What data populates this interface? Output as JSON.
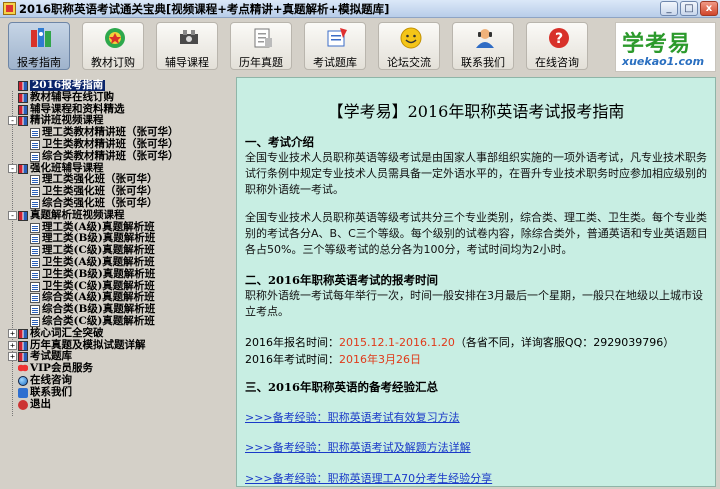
{
  "window": {
    "title": "2016职称英语考试通关宝典[视频课程+考点精讲+真题解析+模拟题库]",
    "buttons": {
      "minimize": "_",
      "maximize": "□",
      "close": "x"
    }
  },
  "toolbar": [
    {
      "label": "报考指南",
      "icon": "guide-icon",
      "active": true
    },
    {
      "label": "教材订购",
      "icon": "order-icon",
      "active": false
    },
    {
      "label": "辅导课程",
      "icon": "course-icon",
      "active": false
    },
    {
      "label": "历年真题",
      "icon": "past-exam-icon",
      "active": false
    },
    {
      "label": "考试题库",
      "icon": "question-bank-icon",
      "active": false
    },
    {
      "label": "论坛交流",
      "icon": "forum-icon",
      "active": false
    },
    {
      "label": "联系我们",
      "icon": "contact-icon",
      "active": false
    },
    {
      "label": "在线咨询",
      "icon": "help-icon",
      "active": false
    }
  ],
  "logo": {
    "cn": "学考易",
    "en": "xuekao1.com"
  },
  "tree": [
    {
      "label": "2016报考指南",
      "level": 0,
      "icon": "book",
      "selected": true
    },
    {
      "label": "教材辅导在线订购",
      "level": 0,
      "icon": "book"
    },
    {
      "label": "辅导课程和资料精选",
      "level": 0,
      "icon": "book"
    },
    {
      "label": "精讲班视频课程",
      "level": 0,
      "icon": "book",
      "expand": "-"
    },
    {
      "label": "理工类教材精讲班（张可华）",
      "level": 1,
      "icon": "doc"
    },
    {
      "label": "卫生类教材精讲班（张可华）",
      "level": 1,
      "icon": "doc"
    },
    {
      "label": "综合类教材精讲班（张可华）",
      "level": 1,
      "icon": "doc"
    },
    {
      "label": "强化班辅导课程",
      "level": 0,
      "icon": "book",
      "expand": "-"
    },
    {
      "label": "理工类强化班（张可华）",
      "level": 1,
      "icon": "doc"
    },
    {
      "label": "卫生类强化班（张可华）",
      "level": 1,
      "icon": "doc"
    },
    {
      "label": "综合类强化班（张可华）",
      "level": 1,
      "icon": "doc"
    },
    {
      "label": "真题解析班视频课程",
      "level": 0,
      "icon": "book",
      "expand": "-"
    },
    {
      "label": "理工类(A级)真题解析班",
      "level": 1,
      "icon": "doc"
    },
    {
      "label": "理工类(B级)真题解析班",
      "level": 1,
      "icon": "doc"
    },
    {
      "label": "理工类(C级)真题解析班",
      "level": 1,
      "icon": "doc"
    },
    {
      "label": "卫生类(A级)真题解析班",
      "level": 1,
      "icon": "doc"
    },
    {
      "label": "卫生类(B级)真题解析班",
      "level": 1,
      "icon": "doc"
    },
    {
      "label": "卫生类(C级)真题解析班",
      "level": 1,
      "icon": "doc"
    },
    {
      "label": "综合类(A级)真题解析班",
      "level": 1,
      "icon": "doc"
    },
    {
      "label": "综合类(B级)真题解析班",
      "level": 1,
      "icon": "doc"
    },
    {
      "label": "综合类(C级)真题解析班",
      "level": 1,
      "icon": "doc"
    },
    {
      "label": "核心词汇全突破",
      "level": 0,
      "icon": "book",
      "expand": "+"
    },
    {
      "label": "历年真题及模拟试题详解",
      "level": 0,
      "icon": "book",
      "expand": "+"
    },
    {
      "label": "考试题库",
      "level": 0,
      "icon": "book",
      "expand": "+"
    },
    {
      "label": "VIP会员服务",
      "level": 0,
      "icon": "heart"
    },
    {
      "label": "在线咨询",
      "level": 0,
      "icon": "globe"
    },
    {
      "label": "联系我们",
      "level": 0,
      "icon": "phone"
    },
    {
      "label": "退出",
      "level": 0,
      "icon": "exit"
    }
  ],
  "content": {
    "title": "【学考易】2016年职称英语考试报考指南",
    "s1_title": "一、考试介绍",
    "s1_p1": "全国专业技术人员职称英语等级考试是由国家人事部组织实施的一项外语考试，凡专业技术职务试行条例中规定专业技术人员需具备一定外语水平的，在晋升专业技术职务时应参加相应级别的职称外语统一考试。",
    "s1_p2": "全国专业技术人员职称英语等级考试共分三个专业类别，综合类、理工类、卫生类。每个专业类别的考试各分A、B、C三个等级。每个级别的试卷内容，除综合类外，普通英语和专业英语题目各占50%。三个等级考试的总分各为100分，考试时间均为2小时。",
    "s2_title": "二、2016年职称英语考试的报考时间",
    "s2_p1": "职称外语统一考试每年举行一次，时间一般安排在3月最后一个星期，一般只在地级以上城市设立考点。",
    "reg_label": "2016年报名时间：",
    "reg_value": "2015.12.1-2016.1.20",
    "reg_note": "（各省不同，详询客服QQ：2929039796）",
    "exam_label": "2016年考试时间：",
    "exam_value": "2016年3月26日",
    "s3_title": "三、2016年职称英语的备考经验汇总",
    "links": [
      ">>>备考经验：职称英语考试有效复习方法",
      ">>>备考经验：职称英语考试及解题方法详解",
      ">>>备考经验：职称英语理工A70分考生经验分享"
    ]
  }
}
